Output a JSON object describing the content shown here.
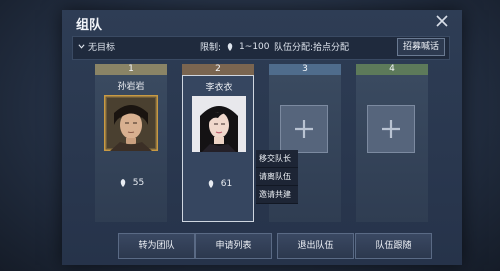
{
  "window": {
    "title": "组队"
  },
  "filter": {
    "target": "无目标",
    "limit_label": "限制:",
    "limit_range": "1~100",
    "distribution": "队伍分配:拾点分配",
    "recruit_button": "招募喊话"
  },
  "slots": [
    {
      "number": "1",
      "name": "孙岩岩",
      "power": "55",
      "occupied": true
    },
    {
      "number": "2",
      "name": "李衣衣",
      "power": "61",
      "occupied": true,
      "selected": true
    },
    {
      "number": "3",
      "occupied": false
    },
    {
      "number": "4",
      "occupied": false
    }
  ],
  "context_menu": [
    "移交队长",
    "请离队伍",
    "邀请共建"
  ],
  "bottom_buttons": [
    "转为团队",
    "申请列表",
    "退出队伍",
    "队伍跟随"
  ],
  "icons": [
    "close-icon",
    "chevron-down-icon",
    "power-icon",
    "add-member-icon"
  ]
}
